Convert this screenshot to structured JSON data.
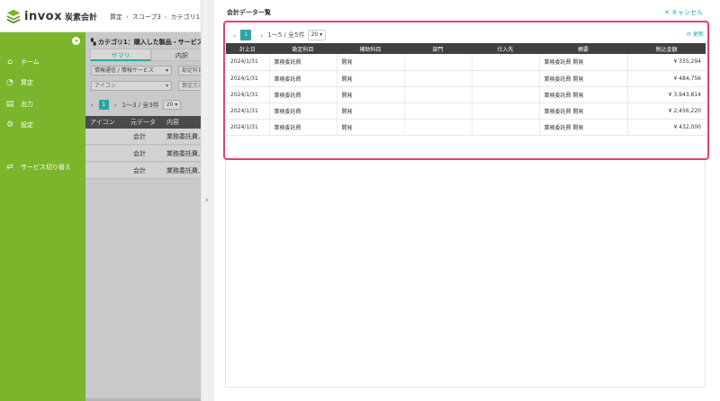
{
  "header": {
    "brand": "invox",
    "brand_sub": "炭素会計",
    "breadcrumb": [
      "算定",
      "スコープ3",
      "カテゴリ1"
    ]
  },
  "sidebar": {
    "items": [
      {
        "label": "ホーム",
        "icon": "home-icon"
      },
      {
        "label": "算定",
        "icon": "pie-chart-icon"
      },
      {
        "label": "出力",
        "icon": "export-icon"
      },
      {
        "label": "設定",
        "icon": "gear-icon"
      },
      {
        "label": "サービス切り替え",
        "icon": "switch-icon"
      }
    ]
  },
  "mid": {
    "title": "カテゴリ1：購入した製品・サービス",
    "tabs": [
      "サマリ",
      "内訳"
    ],
    "filter1": "情報通信 / 情報サービス",
    "filter2": "勘定科目",
    "filter3": "アイコン",
    "filter4": "算定方法",
    "pager": {
      "page": "1",
      "summary": "1〜3 / 全3件",
      "size": "20"
    },
    "columns": [
      "アイコン",
      "元データ",
      "内容"
    ],
    "rows": [
      {
        "source": "会計",
        "content": "業務委託費,"
      },
      {
        "source": "会計",
        "content": "業務委託費,"
      },
      {
        "source": "会計",
        "content": "業務委託費,"
      }
    ]
  },
  "main": {
    "title": "会計データ一覧",
    "cancel_label": "キャンセル",
    "refresh_label": "更新",
    "pager": {
      "page": "1",
      "summary": "1〜5 / 全5件",
      "size": "20"
    },
    "columns": [
      "計上日",
      "勘定科目",
      "補助科目",
      "部門",
      "仕入先",
      "摘要",
      "税込金額"
    ],
    "rows": [
      {
        "date": "2024/1/31",
        "account": "業務委託費",
        "sub": "開発",
        "dept": "",
        "vendor": "",
        "memo": "業務委託費 開発",
        "amount": "¥ 335,294"
      },
      {
        "date": "2024/1/31",
        "account": "業務委託費",
        "sub": "開発",
        "dept": "",
        "vendor": "",
        "memo": "業務委託費 開発",
        "amount": "¥ 484,756"
      },
      {
        "date": "2024/1/31",
        "account": "業務委託費",
        "sub": "開発",
        "dept": "",
        "vendor": "",
        "memo": "業務委託費 開発",
        "amount": "¥ 3,943,814"
      },
      {
        "date": "2024/1/31",
        "account": "業務委託費",
        "sub": "開発",
        "dept": "",
        "vendor": "",
        "memo": "業務委託費 開発",
        "amount": "¥ 2,456,220"
      },
      {
        "date": "2024/1/31",
        "account": "業務委託費",
        "sub": "開発",
        "dept": "",
        "vendor": "",
        "memo": "業務委託費 開発",
        "amount": "¥ 432,000"
      }
    ]
  },
  "colors": {
    "sidebar": "#7bb52b",
    "accent": "#2aa7a5",
    "highlight": "#e2407a"
  }
}
